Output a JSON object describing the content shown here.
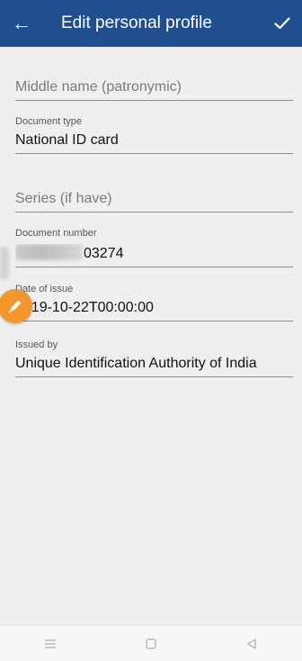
{
  "appbar": {
    "title": "Edit personal profile",
    "back_icon": "arrow-left-icon",
    "confirm_icon": "check-icon",
    "color": "#1f4f8f"
  },
  "fields": {
    "middle_name": {
      "placeholder": "Middle name (patronymic)"
    },
    "document_type": {
      "label": "Document type",
      "value": "National ID card"
    },
    "series": {
      "placeholder": "Series (if have)"
    },
    "document_number": {
      "label": "Document number",
      "value_visible": "03274"
    },
    "date_of_issue": {
      "label": "Date of issue",
      "value": "2019-10-22T00:00:00"
    },
    "issued_by": {
      "label": "Issued by",
      "value": "Unique Identification Authority of India"
    }
  },
  "edit_fab": {
    "icon": "pencil-icon",
    "color": "#f3962b"
  },
  "navbar": {
    "menu_icon": "menu-icon",
    "home_icon": "square-icon",
    "back_icon": "triangle-back-icon"
  }
}
